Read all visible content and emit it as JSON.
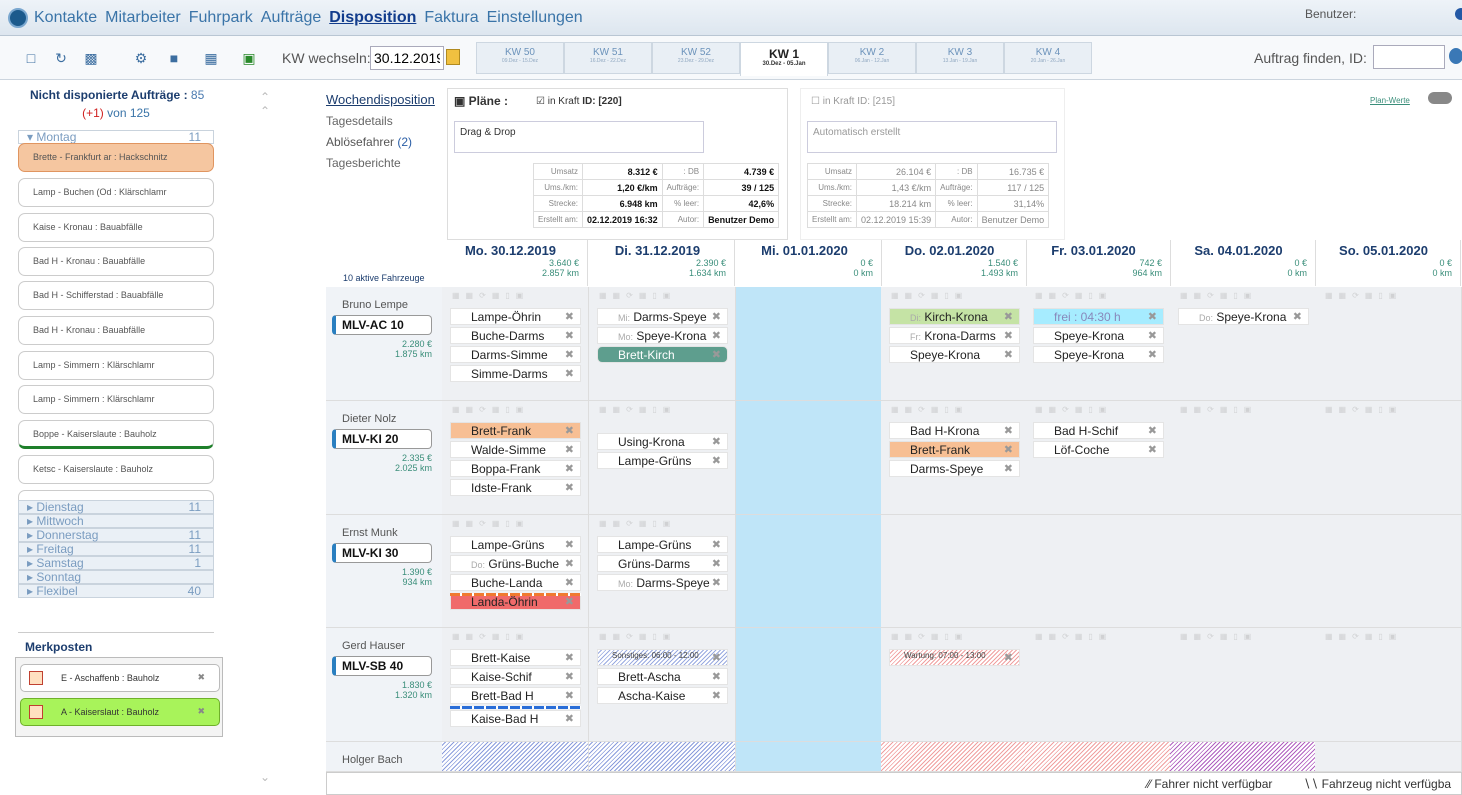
{
  "nav": {
    "menu": [
      "Kontakte",
      "Mitarbeiter",
      "Fuhrpark",
      "Aufträge",
      "Disposition",
      "Faktura",
      "Einstellungen"
    ],
    "user_label": "Benutzer:"
  },
  "toolbar": {
    "icons": [
      "new-document-icon",
      "refresh-icon",
      "page-icon",
      "gear-icon",
      "save-icon",
      "calculator-icon",
      "excel-icon"
    ],
    "kw_label": "KW wechseln:",
    "kw_date": "30.12.2019",
    "weeks": [
      {
        "t": "KW 50",
        "s": "09.Dez - 15.Dez"
      },
      {
        "t": "KW 51",
        "s": "16.Dez - 22.Dez"
      },
      {
        "t": "KW 52",
        "s": "23.Dez - 29.Dez"
      },
      {
        "t": "KW 1",
        "s": "30.Dez - 05.Jan"
      },
      {
        "t": "KW 2",
        "s": "06.Jan - 12.Jan"
      },
      {
        "t": "KW 3",
        "s": "13.Jan - 19.Jan"
      },
      {
        "t": "KW 4",
        "s": "20.Jan - 26.Jan"
      }
    ],
    "find_label": "Auftrag finden, ID:"
  },
  "sidebar": {
    "title": "Nicht disponierte Aufträge :",
    "title_count": "85",
    "sub_plus": "(+1)",
    "sub_von": "von 125",
    "monday": {
      "label": "Montag",
      "count": "11"
    },
    "orders": [
      "Brette - Frankfurt ar : Hackschnitz",
      "Lamp - Buchen (Od : Klärschlamr",
      "Kaise - Kronau : Bauabfälle",
      "Bad H - Kronau : Bauabfälle",
      "Bad H - Schifferstad : Bauabfälle",
      "Bad H - Kronau : Bauabfälle",
      "Lamp - Simmern : Klärschlamr",
      "Lamp - Simmern : Klärschlamr",
      "Boppe - Kaiserslaute : Bauholz",
      "Ketsc - Kaiserslaute : Bauholz",
      "Lamp - Simmern : Klärschlamr"
    ],
    "days": [
      {
        "label": "Dienstag",
        "count": "11"
      },
      {
        "label": "Mittwoch",
        "count": ""
      },
      {
        "label": "Donnerstag",
        "count": "11"
      },
      {
        "label": "Freitag",
        "count": "11"
      },
      {
        "label": "Samstag",
        "count": "1"
      },
      {
        "label": "Sonntag",
        "count": ""
      },
      {
        "label": "Flexibel",
        "count": "40"
      }
    ],
    "merk_title": "Merkposten",
    "merk_items": [
      "E - Aschaffenb : Bauholz",
      "A - Kaiserslaut : Bauholz"
    ]
  },
  "links": {
    "woche": "Wochendisposition",
    "tages": "Tagesdetails",
    "abloese": "Ablösefahrer",
    "abloese_count": "(2)",
    "berichte": "Tagesberichte"
  },
  "plan1": {
    "head": "Pläne :",
    "inkraft": "in Kraft",
    "id": "ID: [220]",
    "note": "Drag & Drop",
    "umsatz": "8.312 €",
    "db": "4.739 €",
    "umskm": "1,20 €/km",
    "auftraege": "39 / 125",
    "strecke": "6.948 km",
    "leer": "42,6%",
    "erstellt": "02.12.2019 16:32",
    "autor": "Benutzer Demo"
  },
  "plan2": {
    "inkraft": "in Kraft",
    "id": "ID: [215]",
    "note": "Automatisch erstellt",
    "umsatz": "26.104 €",
    "db": "16.735 €",
    "umskm": "1,43 €/km",
    "auftraege": "117 / 125",
    "strecke": "18.214 km",
    "leer": "31,14%",
    "erstellt": "02.12.2019 15:39",
    "autor": "Benutzer Demo"
  },
  "stat_labels": {
    "umsatz": "Umsatz",
    "umskm": "Ums./km:",
    "strecke": "Strecke:",
    "erstellt": "Erstellt am:",
    "db": ": DB",
    "auftraege": "Aufträge:",
    "leer": "% leer:",
    "autor": "Autor:"
  },
  "plan_werte": "Plan-Werte",
  "aktive": "10 aktive Fahrzeuge",
  "days": [
    {
      "name": "Mo. 30.12.2019",
      "eur": "3.640 €",
      "km": "2.857 km"
    },
    {
      "name": "Di. 31.12.2019",
      "eur": "2.390 €",
      "km": "1.634 km"
    },
    {
      "name": "Mi. 01.01.2020",
      "eur": "0 €",
      "km": "0 km"
    },
    {
      "name": "Do. 02.01.2020",
      "eur": "1.540 €",
      "km": "1.493 km"
    },
    {
      "name": "Fr. 03.01.2020",
      "eur": "742 €",
      "km": "964 km"
    },
    {
      "name": "Sa. 04.01.2020",
      "eur": "0 €",
      "km": "0 km"
    },
    {
      "name": "So. 05.01.2020",
      "eur": "0 €",
      "km": "0 km"
    }
  ],
  "vehicles": [
    {
      "driver": "Bruno Lempe",
      "plate": "MLV-AC 10",
      "eur": "2.280 €",
      "km": "1.875 km"
    },
    {
      "driver": "Dieter Nolz",
      "plate": "MLV-KI 20",
      "eur": "2.335 €",
      "km": "2.025 km"
    },
    {
      "driver": "Ernst Munk",
      "plate": "MLV-KI 30",
      "eur": "1.390 €",
      "km": "934 km"
    },
    {
      "driver": "Gerd Hauser",
      "plate": "MLV-SB 40",
      "eur": "1.830 €",
      "km": "1.320 km"
    },
    {
      "driver": "Holger Bach",
      "plate": "",
      "eur": "",
      "km": ""
    }
  ],
  "trips": {
    "r0": {
      "d0": [
        "Lampe-Öhrin",
        "Buche-Darms",
        "Darms-Simme",
        "Simme-Darms"
      ],
      "d1_pre": [
        "Mi:",
        "Mo:",
        ""
      ],
      "d1": [
        "Darms-Speye",
        "Speye-Krona",
        "Brett-Kirch"
      ],
      "d3_pre": [
        "Di:",
        "Fr:",
        ""
      ],
      "d3": [
        "Kirch-Krona",
        "Krona-Darms",
        "Speye-Krona"
      ],
      "d4": [
        "frei : 04:30 h",
        "Speye-Krona",
        "Speye-Krona"
      ],
      "d5_pre": "Do:",
      "d5": "Speye-Krona"
    },
    "r1": {
      "d0": [
        "Brett-Frank",
        "Walde-Simme",
        "Boppa-Frank",
        "Idste-Frank"
      ],
      "d1": [
        "Using-Krona",
        "Lampe-Grüns"
      ],
      "d3": [
        "Bad H-Krona",
        "Brett-Frank",
        "Darms-Speye"
      ],
      "d4": [
        "Bad H-Schif",
        "Löf-Coche"
      ]
    },
    "r2": {
      "d0_pre": [
        "",
        "Do:",
        ""
      ],
      "d0": [
        "Lampe-Grüns",
        "Grüns-Buche",
        "Buche-Landa",
        "Landa-Öhrin"
      ],
      "d1_pre": [
        "",
        "",
        "Mo:"
      ],
      "d1": [
        "Lampe-Grüns",
        "Grüns-Darms",
        "Darms-Speye"
      ]
    },
    "r3": {
      "d0": [
        "Brett-Kaise",
        "Kaise-Schif",
        "Brett-Bad H",
        "Kaise-Bad H"
      ],
      "d1": [
        "Sonstiges: 06:00 - 12:00",
        "Brett-Ascha",
        "Ascha-Kaise"
      ],
      "d3": "Wartung: 07:00 - 13:00"
    }
  },
  "legend": {
    "l1": "Fahrer nicht verfügbar",
    "l2": "Fahrzeug nicht verfügba"
  }
}
